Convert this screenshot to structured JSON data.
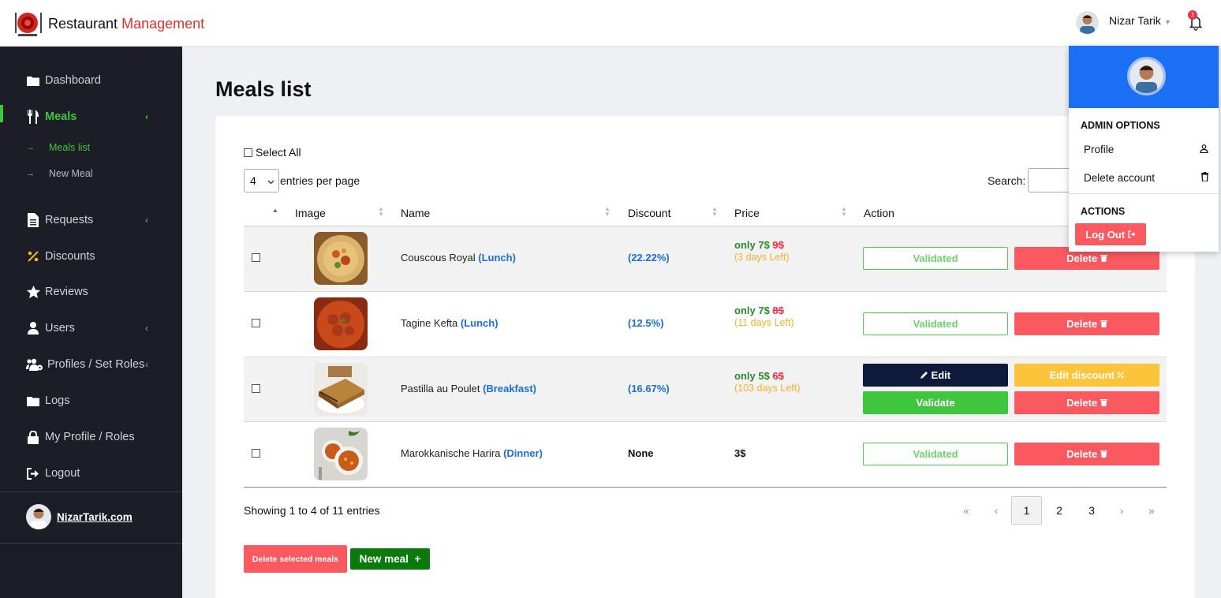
{
  "app": {
    "brand_primary": "Restaurant",
    "brand_accent": "Management",
    "user_name": "Nizar Tarik",
    "notification_count": "1"
  },
  "sidebar": {
    "items": [
      {
        "label": "Dashboard",
        "icon": "folder-icon"
      },
      {
        "label": "Meals",
        "icon": "utensils-icon",
        "active": true
      },
      {
        "label": "Requests",
        "icon": "file-icon"
      },
      {
        "label": "Discounts",
        "icon": "percent-icon"
      },
      {
        "label": "Reviews",
        "icon": "star-icon"
      },
      {
        "label": "Users",
        "icon": "user-icon"
      },
      {
        "label": "Profiles / Set Roles",
        "icon": "users-cog-icon"
      },
      {
        "label": "Logs",
        "icon": "folder-icon"
      },
      {
        "label": "My Profile / Roles",
        "icon": "lock-icon"
      },
      {
        "label": "Logout",
        "icon": "sign-out-icon"
      }
    ],
    "sub_items": [
      {
        "label": "Meals list",
        "active": true
      },
      {
        "label": "New Meal"
      }
    ],
    "footer_link": "NizarTarik.com"
  },
  "main": {
    "title": "Meals list",
    "select_all": "Select All",
    "entries_value": "4",
    "entries_label": "entries per page",
    "search_label": "Search:",
    "columns": [
      "Image",
      "Name",
      "Discount",
      "Price",
      "Action"
    ],
    "rows": [
      {
        "name": "Couscous Royal",
        "category": "(Lunch)",
        "discount": "(22.22%)",
        "price_only": "only 7$",
        "price_old": "9$",
        "days_left": "(3 days Left)",
        "status": "Validated"
      },
      {
        "name": "Tagine Kefta",
        "category": "(Lunch)",
        "discount": "(12.5%)",
        "price_only": "only 7$",
        "price_old": "8$",
        "days_left": "(11 days Left)",
        "status": "Validated"
      },
      {
        "name": "Pastilla au Poulet",
        "category": "(Breakfast)",
        "discount": "(16.67%)",
        "price_only": "only 5$",
        "price_old": "6$",
        "days_left": "(103 days Left)",
        "status": "Validate"
      },
      {
        "name": "Marokkanische Harira",
        "category": "(Dinner)",
        "discount": "None",
        "price": "3$",
        "status": "Validated"
      }
    ],
    "btn_edit": "Edit",
    "btn_edit_discount": "Edit discount",
    "btn_delete": "Delete",
    "showing": "Showing 1 to 4 of 11 entries",
    "pagination": {
      "first": "«",
      "prev": "‹",
      "pages": [
        "1",
        "2",
        "3"
      ],
      "current": "1",
      "next": "›",
      "last": "»"
    },
    "btn_delete_selected": "Delete selected meals",
    "btn_new_meal": "New meal"
  },
  "dropdown": {
    "admin_options": "ADMIN OPTIONS",
    "profile": "Profile",
    "delete_account": "Delete account",
    "actions": "ACTIONS",
    "logout": "Log Out"
  },
  "colors": {
    "sidebar_bg": "#1c1d27",
    "accent_green": "#3ec63e",
    "delete_red": "#f9595f",
    "link_blue": "#1a6fd8",
    "dropdown_header": "#1a6ff5"
  }
}
